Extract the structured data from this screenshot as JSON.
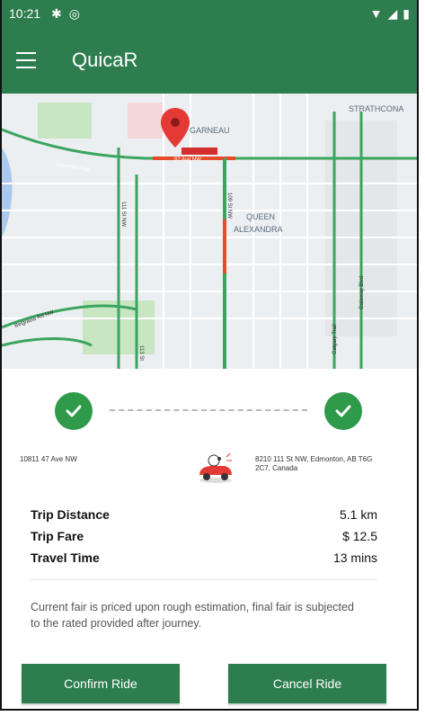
{
  "status_bar": {
    "time": "10:21",
    "icons": [
      "gear-icon",
      "privacy-icon"
    ],
    "right_icons": [
      "wifi-icon",
      "signal-icon",
      "battery-icon"
    ]
  },
  "app_bar": {
    "title": "QuicaR"
  },
  "map": {
    "labels": [
      "GARNEAU",
      "QUEEN",
      "ALEXANDRA",
      "STRATHCONA",
      "University Ave",
      "82 Ave NW",
      "111 St NW",
      "109 St NW",
      "Belgravia Rd NW",
      "113 St",
      "Gateway Blvd",
      "Calgary Trail"
    ]
  },
  "trip": {
    "start_address": "10811 47 Ave NW",
    "end_address": "8210 111 St NW, Edmonton, AB T6G 2C7, Canada"
  },
  "details": [
    {
      "label": "Trip Distance",
      "value": "5.1 km"
    },
    {
      "label": "Trip Fare",
      "value": "$ 12.5"
    },
    {
      "label": "Travel Time",
      "value": "13 mins"
    }
  ],
  "note": "Current fair is priced upon rough estimation, final fair is subjected to the rated provided after journey.",
  "buttons": {
    "confirm": "Confirm Ride",
    "cancel": "Cancel Ride"
  },
  "colors": {
    "primary": "#2e7d4f",
    "check": "#2e9a4a",
    "pin": "#e53935"
  }
}
